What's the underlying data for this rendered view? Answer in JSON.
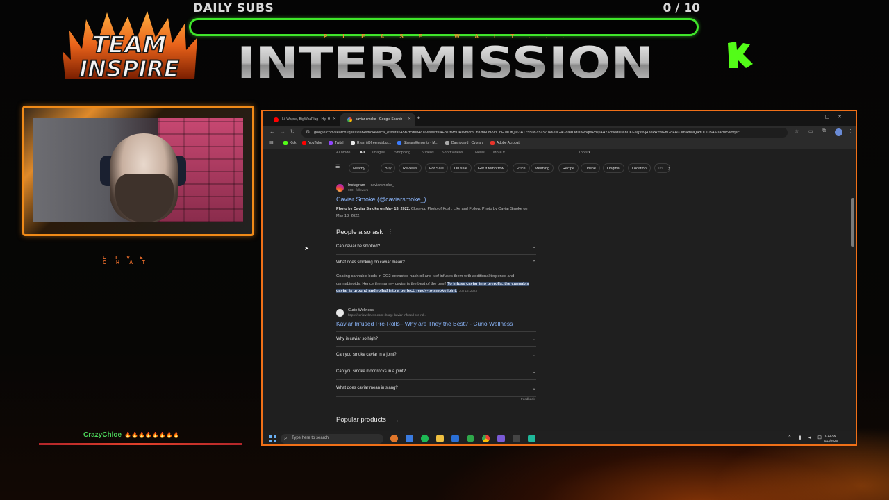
{
  "overlay": {
    "logo_text": "TEAM INSPIRE",
    "daily_subs_label": "DAILY SUBS",
    "subs_count": "0  / 10",
    "subs_progress": 0.0,
    "please_wait": "PLEASE WAIT...",
    "title": "INTERMISSION",
    "live_chat_label": "LIVE CHAT",
    "accent_color": "#3fe62a",
    "frame_color": "#f08a18"
  },
  "chat": {
    "user": "CrazyChloe",
    "message": "🔥🔥🔥🔥🔥🔥🔥🔥"
  },
  "browser": {
    "tabs": [
      {
        "title": "Lil Wayne, BigWhaPlug - Hip-H",
        "icon": "youtube-icon",
        "active": false
      },
      {
        "title": "caviar smoke - Google Search",
        "icon": "google-icon",
        "active": true
      }
    ],
    "url": "google.com/search?q=caviar+smoke&sca_esv=fa545b2fcd0b4c1a&sxsrf=AE3TifM5DHWmcmCnKm6U9-9rlCnEJaOtQ%3A1755087323204&ei=24GcaXOdDIW3qtsP8sjI4AY&oved=0ahUKEwjj9svj4YePAxWFm2oFHXJmAmwQ4dUDCBA&uact=5&oq=c...",
    "bookmarks": [
      {
        "label": "Kick",
        "color": "#53fc18"
      },
      {
        "label": "YouTube",
        "color": "#ff0000"
      },
      {
        "label": "Twitch",
        "color": "#9146ff"
      },
      {
        "label": "Ryan (@freemdabul...",
        "color": "#e8e8e8"
      },
      {
        "label": "StreamElements - M...",
        "color": "#3b7cff"
      },
      {
        "label": "Dashboard | Cybrary",
        "color": "#aaaaaa"
      },
      {
        "label": "Adobe Acrobat",
        "color": "#e8342a"
      }
    ],
    "search_tabs": [
      "AI Mode",
      "All",
      "Images",
      "Shopping",
      "Videos",
      "Short videos",
      "News",
      "More ▾"
    ],
    "tools_label": "Tools ▾",
    "chips": [
      "Nearby",
      "Buy",
      "Reviews",
      "For Sale",
      "On sale",
      "Get it tomorrow",
      "Price",
      "Meaning",
      "Recipe",
      "Online",
      "Original",
      "Location",
      "Im..."
    ],
    "instagram_result": {
      "source": "Instagram",
      "handle": "caviarsmoke_",
      "followers": "650+ followers",
      "title": "Caviar Smoke (@caviarsmoke_)",
      "snippet_bold": "Photo by Caviar Smoke on May 13, 2022.",
      "snippet_rest": " Close-up Photo of Kush. Like and Follow. Photo by Caviar Smoke on May 13, 2022."
    },
    "people_also_ask": {
      "heading": "People also ask",
      "questions": [
        "Can caviar be smoked?",
        "What does smoking on caviar mean?",
        "Why is caviar so high?",
        "Can you smoke caviar in a joint?",
        "Can you smoke moonrocks in a joint?",
        "What does caviar mean in slang?"
      ],
      "answer_plain": "Coating cannabis buds in CO2-extracted hash oil and kief infuses them with additional terpenes and cannabinoids. Hence the name– caviar is the best of the best! ",
      "answer_highlight": "To infuse caviar into prerolls, the cannabis caviar is ground and rolled into a perfect, ready-to-smoke joint.",
      "answer_date": "Jun 16, 2023",
      "answer_source": "Curio Wellness",
      "answer_url": "https://curiowellness.com › blog › kaviar-infused-pre-rol...",
      "answer_title": "Kaviar Infused Pre-Rolls– Why are They the Best? - Curio Wellness",
      "feedback": "Feedback"
    },
    "popular_products_heading": "Popular products"
  },
  "taskbar": {
    "search_placeholder": "Type here to search",
    "time": "8:13 AM",
    "date": "8/13/2025"
  }
}
